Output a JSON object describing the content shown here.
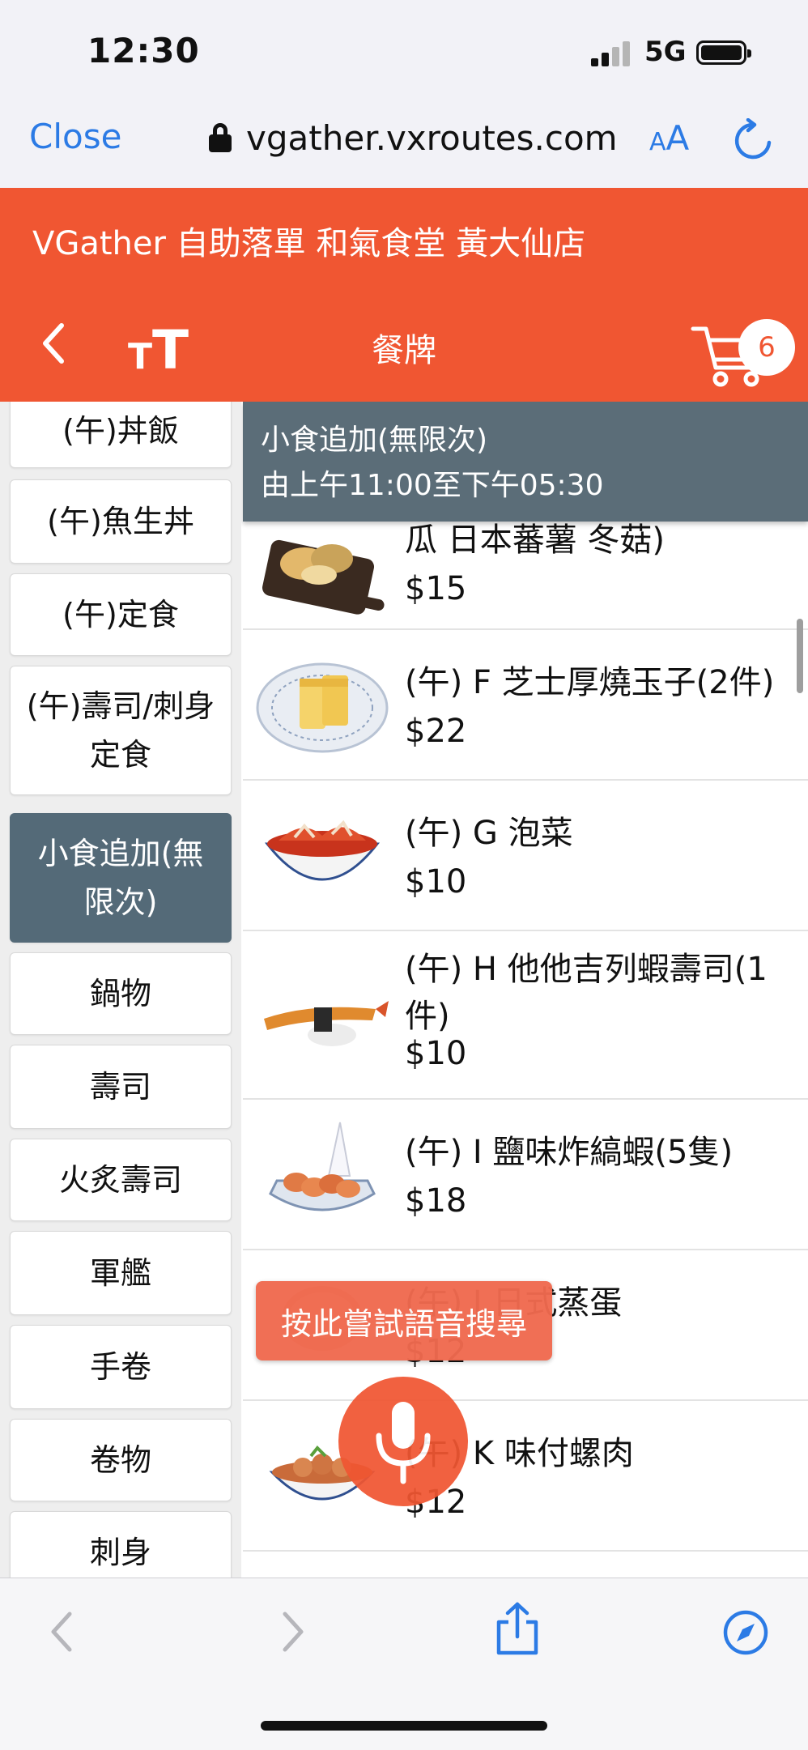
{
  "status_bar": {
    "time": "12:30",
    "network": "5G"
  },
  "browser": {
    "close_label": "Close",
    "url": "vgather.vxroutes.com",
    "text_size_small": "A",
    "text_size_large": "A"
  },
  "header": {
    "store_name": "VGather 自助落單 和氣食堂 黃大仙店",
    "title": "餐牌",
    "text_size_small": "T",
    "text_size_large": "T",
    "cart_count": "6"
  },
  "categories": [
    {
      "label": "(午)丼飯",
      "active": false
    },
    {
      "label": "(午)魚生丼",
      "active": false
    },
    {
      "label": "(午)定食",
      "active": false
    },
    {
      "label": "(午)壽司/刺身定食",
      "active": false
    },
    {
      "label": "小食追加(無限次)",
      "active": true
    },
    {
      "label": "鍋物",
      "active": false
    },
    {
      "label": "壽司",
      "active": false
    },
    {
      "label": "火炙壽司",
      "active": false
    },
    {
      "label": "軍艦",
      "active": false
    },
    {
      "label": "手卷",
      "active": false
    },
    {
      "label": "卷物",
      "active": false
    },
    {
      "label": "刺身",
      "active": false
    }
  ],
  "section": {
    "title": "小食追加(無限次)",
    "hours": "由上午11:00至下午05:30"
  },
  "items": [
    {
      "name": "瓜 日本蕃薯 冬菇)",
      "price": "$15"
    },
    {
      "name": "(午) F 芝士厚燒玉子(2件)",
      "price": "$22"
    },
    {
      "name": "(午) G 泡菜",
      "price": "$10"
    },
    {
      "name": "(午) H 他他吉列蝦壽司(1件)",
      "price": "$10"
    },
    {
      "name": "(午) I 鹽味炸縞蝦(5隻)",
      "price": "$18"
    },
    {
      "name": "(午) J 日式蒸蛋",
      "price": "$12"
    },
    {
      "name": "(午) K 味付螺肉",
      "price": "$12"
    }
  ],
  "voice_search": {
    "tip": "按此嘗試語音搜尋"
  },
  "colors": {
    "brand": "#f05632",
    "section_header": "#5b6d78",
    "active_category": "#546a78",
    "ios_blue": "#2c7be5"
  }
}
